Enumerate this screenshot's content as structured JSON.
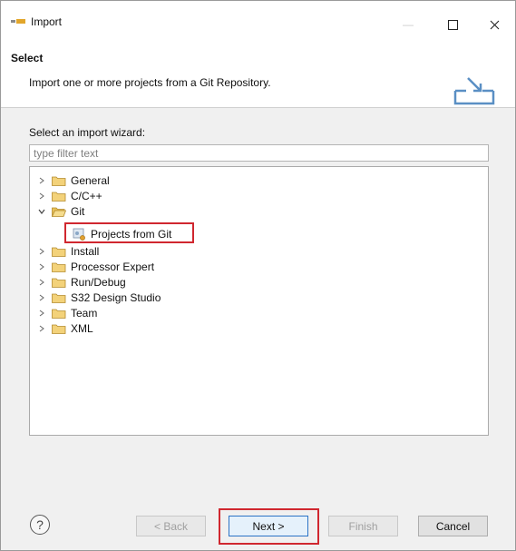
{
  "window": {
    "title": "Import",
    "minimize": "—",
    "maximize": "☐",
    "close": "✕"
  },
  "header": {
    "title": "Select",
    "description": "Import one or more projects from a Git Repository."
  },
  "wizard": {
    "label": "Select an import wizard:",
    "filter_placeholder": "type filter text",
    "filter_value": ""
  },
  "tree": {
    "items": [
      {
        "label": "General",
        "expanded": false
      },
      {
        "label": "C/C++",
        "expanded": false
      },
      {
        "label": "Git",
        "expanded": true
      },
      {
        "label": "Install",
        "expanded": false
      },
      {
        "label": "Processor Expert",
        "expanded": false
      },
      {
        "label": "Run/Debug",
        "expanded": false
      },
      {
        "label": "S32 Design Studio",
        "expanded": false
      },
      {
        "label": "Team",
        "expanded": false
      },
      {
        "label": "XML",
        "expanded": false
      }
    ],
    "git_child": "Projects from Git"
  },
  "footer": {
    "help": "?",
    "back": "< Back",
    "next": "Next >",
    "finish": "Finish",
    "cancel": "Cancel"
  },
  "colors": {
    "highlight": "#d0272f",
    "folder": "#e8c25a",
    "accent": "#2b73c6"
  }
}
